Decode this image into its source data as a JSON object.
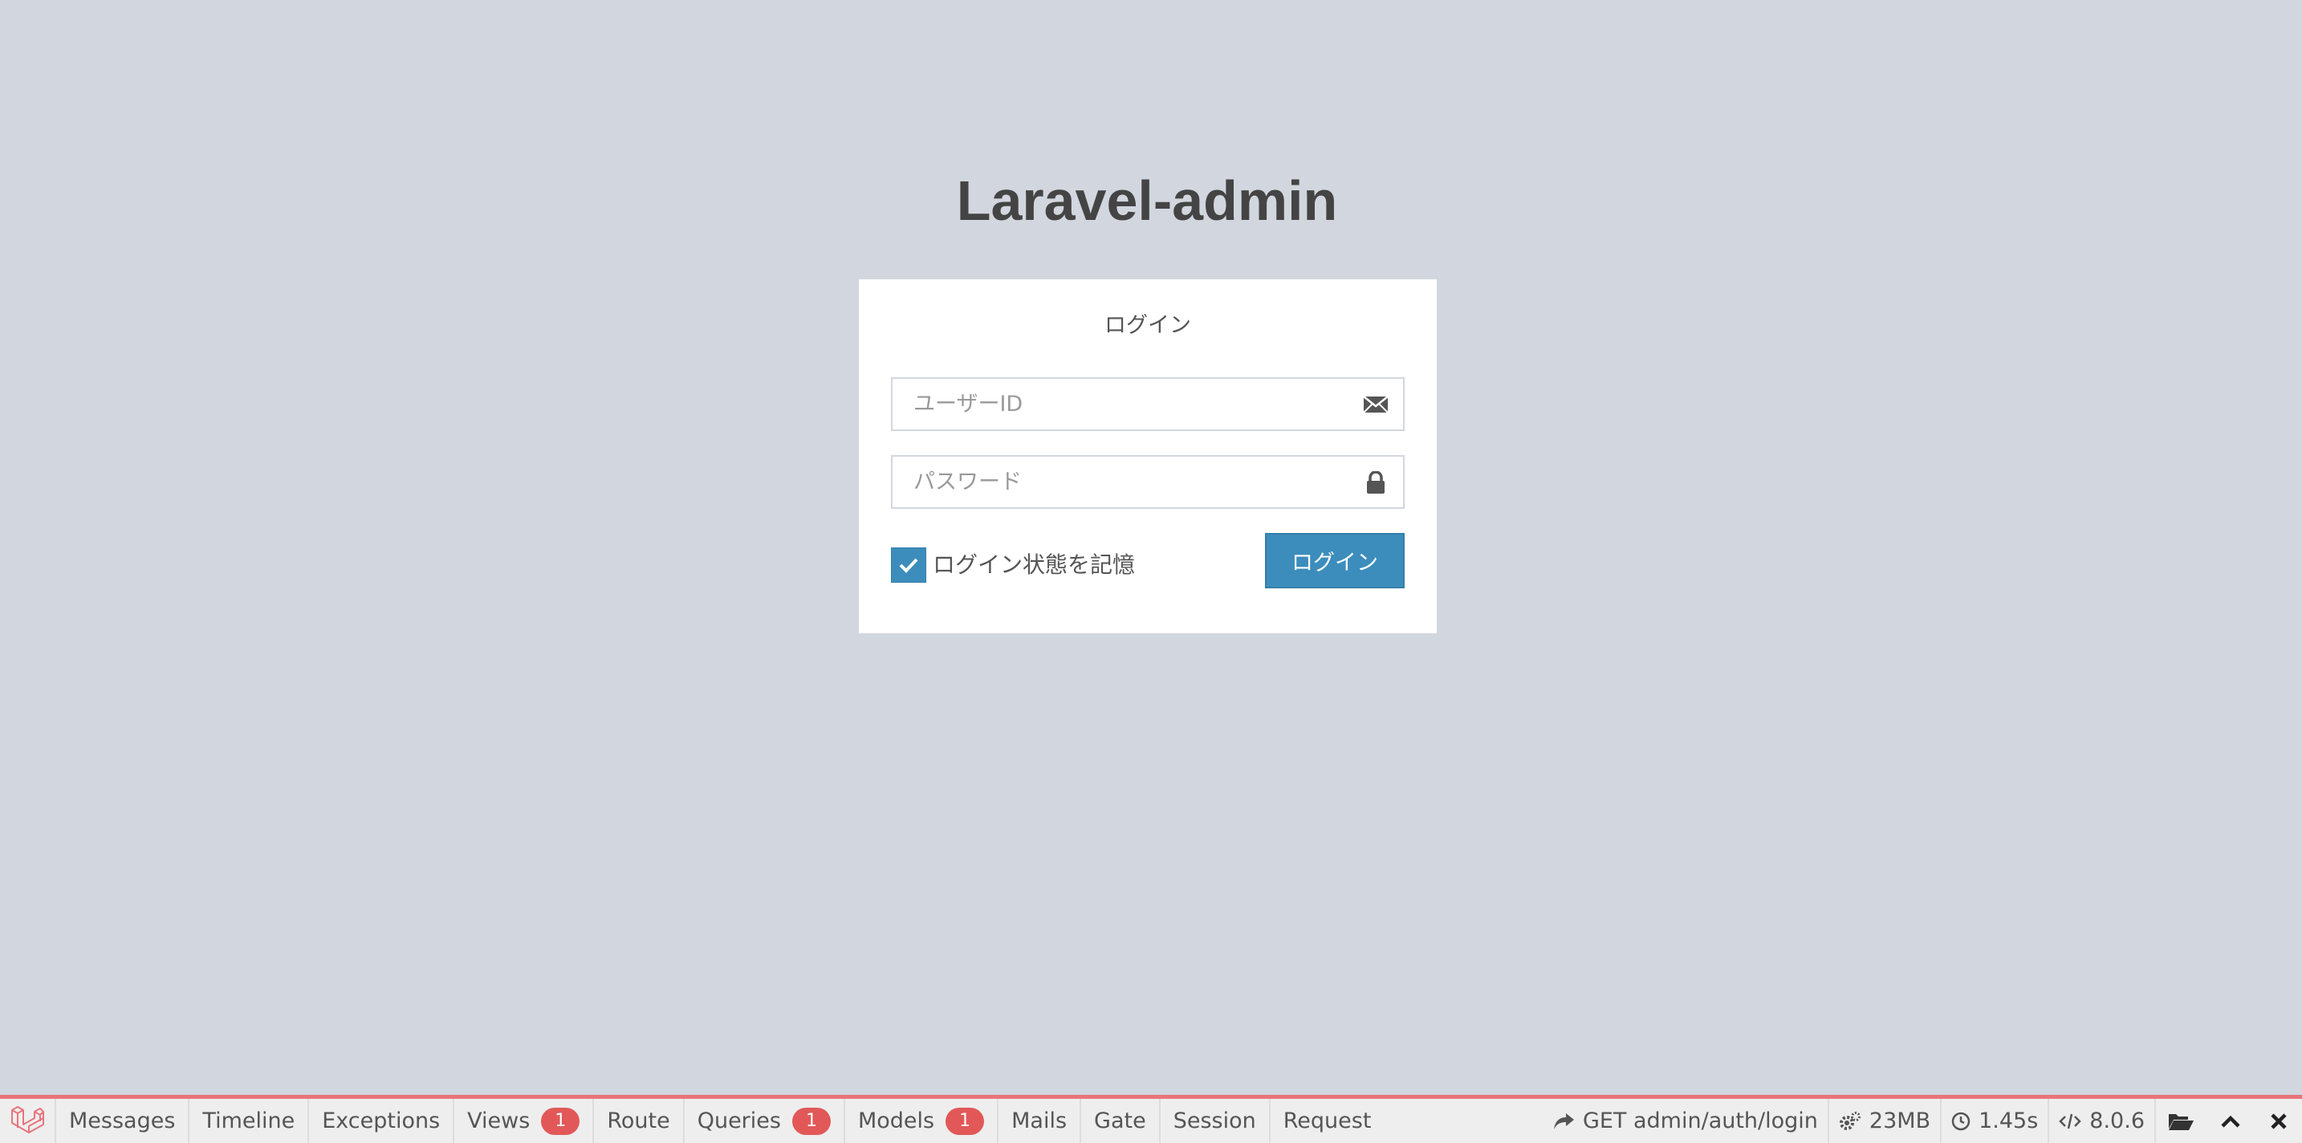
{
  "app": {
    "title": "Laravel-admin"
  },
  "login": {
    "heading": "ログイン",
    "username_placeholder": "ユーザーID",
    "password_placeholder": "パスワード",
    "remember_label": "ログイン状態を記憶",
    "remember_checked": true,
    "submit_label": "ログイン",
    "accent_color": "#3c8dbc"
  },
  "debugbar": {
    "tabs": [
      {
        "label": "Messages",
        "badge": null
      },
      {
        "label": "Timeline",
        "badge": null
      },
      {
        "label": "Exceptions",
        "badge": null
      },
      {
        "label": "Views",
        "badge": "1"
      },
      {
        "label": "Route",
        "badge": null
      },
      {
        "label": "Queries",
        "badge": "1"
      },
      {
        "label": "Models",
        "badge": "1"
      },
      {
        "label": "Mails",
        "badge": null
      },
      {
        "label": "Gate",
        "badge": null
      },
      {
        "label": "Session",
        "badge": null
      },
      {
        "label": "Request",
        "badge": null
      }
    ],
    "request": "GET admin/auth/login",
    "memory": "23MB",
    "duration": "1.45s",
    "php_version": "8.0.6",
    "accent_color": "#e8747b",
    "badge_color": "#e25858",
    "icons": [
      "laravel-logo-icon",
      "share-icon",
      "gears-icon",
      "clock-icon",
      "code-icon",
      "folder-open-icon",
      "chevron-up-icon",
      "close-icon"
    ]
  }
}
